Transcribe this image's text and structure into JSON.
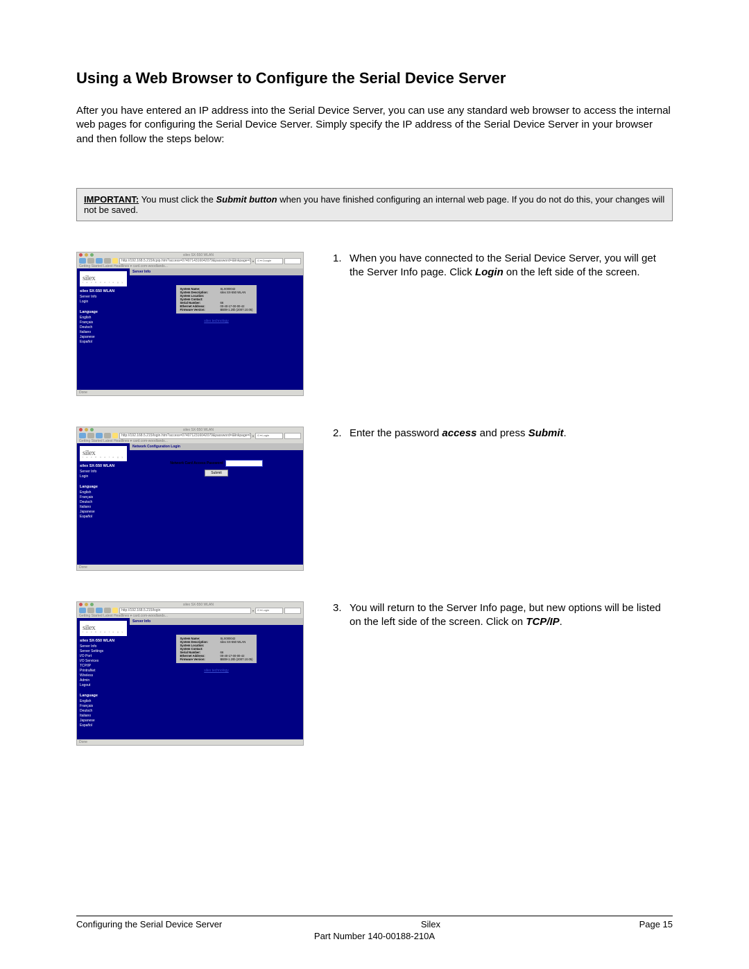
{
  "heading": "Using a Web Browser to Configure the Serial Device Server",
  "intro": "After you have entered an IP address into the Serial Device Server, you can use any standard web browser to access the internal web pages for configuring the Serial Device Server.  Simply specify the IP address of the Serial Device Server in your browser and then follow the steps below:",
  "notice": {
    "important": "IMPORTANT:",
    "text_a": "  You must click the ",
    "submit": "Submit button",
    "text_b": " when you have finished configuring an internal web page.  If you do not do this, your changes will not be saved."
  },
  "steps": [
    {
      "num": "1.",
      "body_html": "When you have connected to the Serial Device Server, you will get the Server Info page.  Click <b>Login</b> on the left side of the screen."
    },
    {
      "num": "2.",
      "body_html": "Enter the password <b>access</b> and press <b>Submit</b>."
    },
    {
      "num": "3.",
      "body_html": "You will return to the Server Info page, but new options will be listed on the left side of the screen.  Click on <b>TCP/IP</b>."
    }
  ],
  "browser": {
    "title": "silex SX-550 WLAN",
    "urls": [
      "http://192.168.5.215/tcpip.htm?access=0740714316042079&password=&linkpage=0",
      "http://192.168.5.215/login.htm?access=0740712316042079&password=&linkpage=0",
      "http://192.168.5.215/login"
    ],
    "search_placeholder": "Google",
    "bookmarks": "Getting Started   Latest Headlines ▾   card.com-woodlands...",
    "logo": "silex",
    "logo_sub": "t e c h n o l o g y",
    "device": "silex SX-550 WLAN",
    "side": {
      "basic": [
        "Server Info",
        "Login"
      ],
      "lang_label": "Language",
      "languages": [
        "English",
        "Français",
        "Deutsch",
        "Italiano",
        "Japanese",
        "Español"
      ],
      "full": [
        "Server Info",
        "Server Settings",
        "I/O Port",
        "I/O Services",
        "TCP/IP",
        "PrintraNet",
        "Wireless",
        "Admin",
        "Logout"
      ]
    },
    "main_titles": {
      "server_info": "Server Info",
      "login": "Network Configuration Login"
    },
    "server_info": [
      {
        "label": "System Name:",
        "value": "SLX000042"
      },
      {
        "label": "System Description:",
        "value": "silex SX-550 WLAN"
      },
      {
        "label": "System Location:",
        "value": ""
      },
      {
        "label": "System Contact:",
        "value": ""
      },
      {
        "label": "Serial Number:",
        "value": "66"
      },
      {
        "label": "Ethernet Address:",
        "value": "00-40-17-00-00-42"
      },
      {
        "label": "Firmware Version:",
        "value": "BB08-1.20b (2007.10.05)"
      }
    ],
    "login_label": "Network Card Access Password",
    "login_button": "Submit",
    "footer_link": "silex technology",
    "status": "Done",
    "search_right_label": "Login"
  },
  "footer": {
    "left": "Configuring the Serial Device Server",
    "center": "Silex",
    "right": "Page 15",
    "part": "Part Number 140-00188-210A"
  }
}
